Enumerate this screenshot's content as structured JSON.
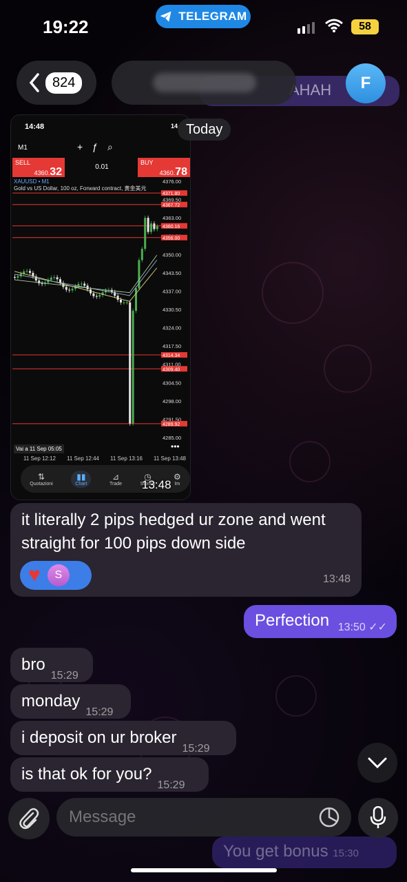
{
  "status_bar": {
    "time": "19:22",
    "app_pill": "TELEGRAM",
    "battery": "58"
  },
  "header": {
    "back_count": "824",
    "avatar_initial": "F",
    "hidden_message_text": "AHAH"
  },
  "today_label": "Today",
  "image_message": {
    "time": "13:48",
    "screenshot": {
      "status_time": "14:48",
      "status_battery": "14",
      "timeframe": "M1",
      "sell_label": "SELL",
      "sell_price_small": "4360.",
      "sell_price_big": "32",
      "lot": "0.01",
      "buy_label": "BUY",
      "buy_price_small": "4360.",
      "buy_price_big": "78",
      "symbol_line": "XAUUSD • M1",
      "description_line": "Gold vs US Dollar, 100 oz, Forward contract, 黄金美元",
      "goto_label": "Vai a 11 Sep 05:05",
      "y_ticks": [
        "4376.00",
        "4369.50",
        "4363.00",
        "4356.50",
        "4350.00",
        "4343.50",
        "4337.00",
        "4330.50",
        "4324.00",
        "4317.50",
        "4311.00",
        "4304.50",
        "4298.00",
        "4291.50",
        "4285.00"
      ],
      "red_level_labels": [
        "4371.80",
        "4367.72",
        "4360.16",
        "4356.00",
        "4314.34",
        "4309.40",
        "4289.92"
      ],
      "x_labels": [
        "11 Sep 12:12",
        "11 Sep 12:44",
        "11 Sep 13:16",
        "11 Sep 13:48"
      ],
      "nav": [
        {
          "label": "Quotazioni",
          "icon": "arrows-icon"
        },
        {
          "label": "Chart",
          "icon": "candles-icon"
        },
        {
          "label": "Trade",
          "icon": "chart-line-icon"
        },
        {
          "label": "Storico",
          "icon": "history-icon"
        },
        {
          "label": "Im",
          "icon": "gear-icon"
        }
      ]
    }
  },
  "messages": [
    {
      "direction": "in",
      "text": "it literally 2 pips hedged ur zone and went straight for 100 pips down side",
      "time": "13:48",
      "reaction_avatar": "S"
    },
    {
      "direction": "out",
      "text": "Perfection",
      "time": "13:50"
    },
    {
      "direction": "in",
      "text": "bro",
      "time": "15:29"
    },
    {
      "direction": "in",
      "text": "monday",
      "time": "15:29"
    },
    {
      "direction": "in",
      "text": "i deposit on ur broker",
      "time": "15:29"
    },
    {
      "direction": "in",
      "text": "is that ok for you?",
      "time": "15:29"
    }
  ],
  "input": {
    "placeholder": "Message"
  },
  "ghost_bubble": {
    "text": "You get bonus",
    "time": "15:30"
  },
  "colors": {
    "outgoing_bubble": "#6a4fe0",
    "incoming_bubble": "#2a2530",
    "accent": "#1f88e5",
    "reaction": "#3d7de8"
  }
}
